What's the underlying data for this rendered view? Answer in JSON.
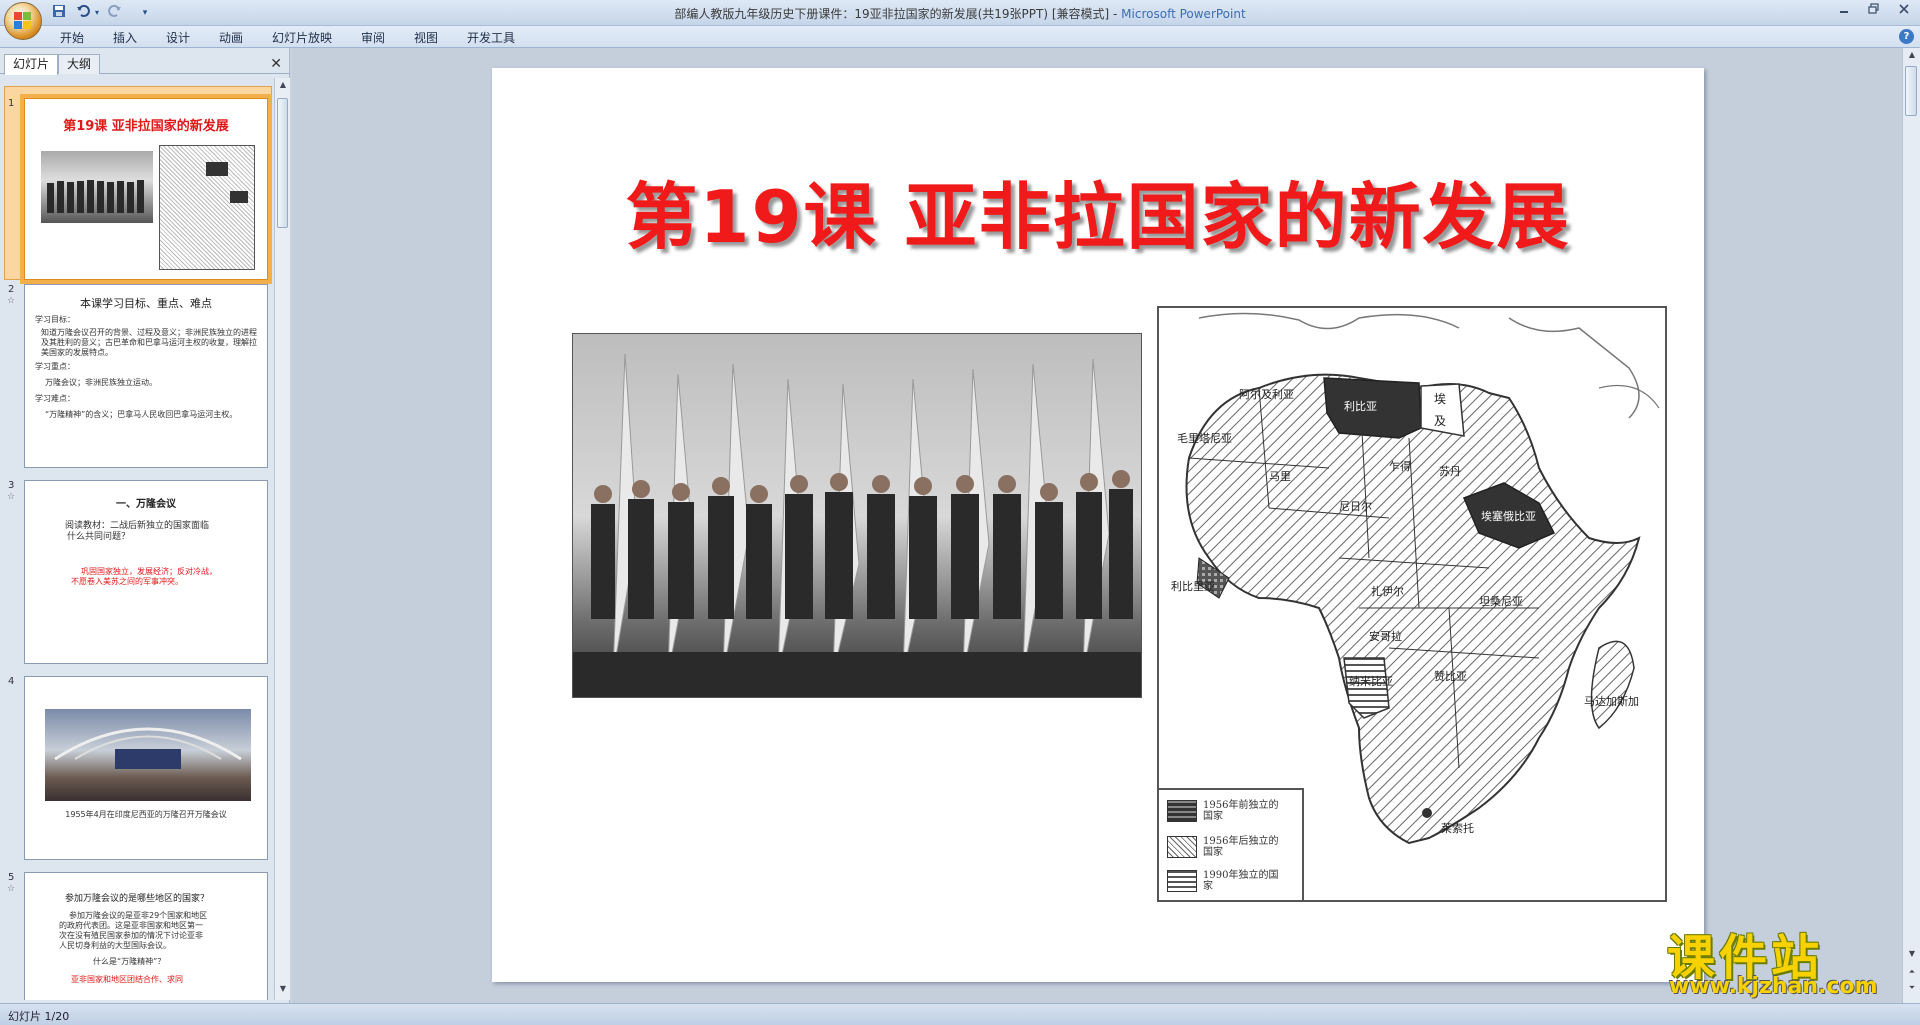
{
  "window": {
    "title": "部编人教版九年级历史下册课件：19亚非拉国家的新发展(共19张PPT) [兼容模式] - ",
    "app_name": "Microsoft PowerPoint"
  },
  "quick_access": {
    "save_icon": "save-icon",
    "undo_icon": "undo-icon",
    "redo_icon": "redo-icon",
    "more": "▾"
  },
  "ribbon": {
    "tabs": [
      "开始",
      "插入",
      "设计",
      "动画",
      "幻灯片放映",
      "审阅",
      "视图",
      "开发工具"
    ]
  },
  "left_panel": {
    "tabs": [
      "幻灯片",
      "大纲"
    ],
    "close": "✕"
  },
  "thumbnails": [
    {
      "num": "1",
      "title": "第19课  亚非拉国家的新发展"
    },
    {
      "num": "2",
      "title": "本课学习目标、重点、难点",
      "lines": [
        "学习目标：",
        "知道万隆会议召开的背景、过程及意义；非洲民族独立的进程及其胜利的意义；古巴革命和巴拿马运河主权的收复，理解拉美国家的发展特点。",
        "学习重点：",
        "万隆会议；非洲民族独立运动。",
        "学习难点：",
        "“万隆精神”的含义；巴拿马人民收回巴拿马运河主权。"
      ]
    },
    {
      "num": "3",
      "title": "一、万隆会议",
      "lines": [
        "阅读教材：二战后新独立的国家面临",
        "什么共同问题？"
      ],
      "red_lines": [
        "巩固国家独立，发展经济；反对冷战，",
        "不愿卷入美苏之间的军事冲突。"
      ]
    },
    {
      "num": "4",
      "caption": "1955年4月在印度尼西亚的万隆召开万隆会议"
    },
    {
      "num": "5",
      "title": "参加万隆会议的是哪些地区的国家？",
      "lines": [
        "参加万隆会议的是亚非29个国家和地区",
        "的政府代表团。这是亚非国家和地区第一",
        "次在没有殖民国家参加的情况下讨论亚非",
        "人民切身利益的大型国际会议。",
        "什么是“万隆精神”？"
      ],
      "red_lines": [
        "亚非国家和地区团结合作、求同"
      ]
    }
  ],
  "slide": {
    "title": "第19课  亚非拉国家的新发展",
    "map": {
      "labels": [
        "阿尔及利亚",
        "利比亚",
        "埃及",
        "毛里塔尼亚",
        "马里",
        "尼日尔",
        "乍得",
        "苏丹",
        "埃塞俄比亚",
        "利比里亚",
        "扎伊尔",
        "坦桑尼亚",
        "安哥拉",
        "纳米比亚",
        "马达加斯加",
        "莱索托",
        "赞比亚"
      ],
      "legend": [
        "1956年前独立的国家",
        "1956年后独立的国家",
        "1990年独立的国家"
      ]
    }
  },
  "status": {
    "text": "幻灯片 1/20"
  },
  "watermark": {
    "big": "课件站",
    "url": "www.kjzhan.com"
  }
}
